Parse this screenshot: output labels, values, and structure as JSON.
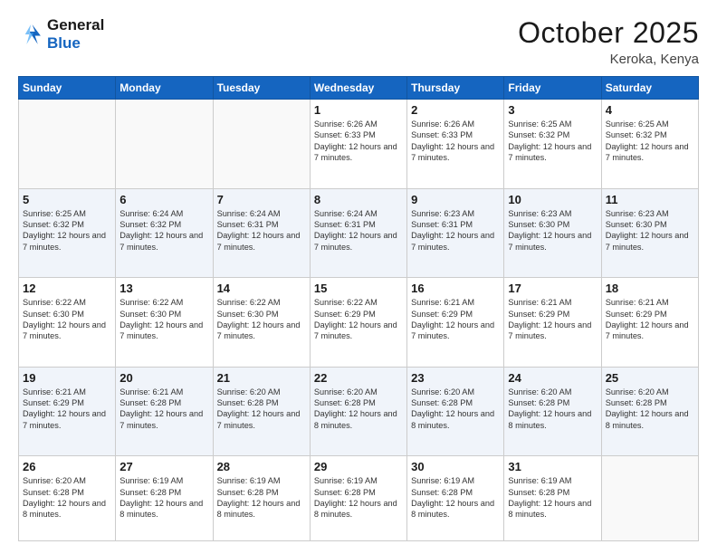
{
  "header": {
    "logo_line1": "General",
    "logo_line2": "Blue",
    "month": "October 2025",
    "location": "Keroka, Kenya"
  },
  "weekdays": [
    "Sunday",
    "Monday",
    "Tuesday",
    "Wednesday",
    "Thursday",
    "Friday",
    "Saturday"
  ],
  "weeks": [
    [
      {
        "day": "",
        "detail": ""
      },
      {
        "day": "",
        "detail": ""
      },
      {
        "day": "",
        "detail": ""
      },
      {
        "day": "1",
        "detail": "Sunrise: 6:26 AM\nSunset: 6:33 PM\nDaylight: 12 hours\nand 7 minutes."
      },
      {
        "day": "2",
        "detail": "Sunrise: 6:26 AM\nSunset: 6:33 PM\nDaylight: 12 hours\nand 7 minutes."
      },
      {
        "day": "3",
        "detail": "Sunrise: 6:25 AM\nSunset: 6:32 PM\nDaylight: 12 hours\nand 7 minutes."
      },
      {
        "day": "4",
        "detail": "Sunrise: 6:25 AM\nSunset: 6:32 PM\nDaylight: 12 hours\nand 7 minutes."
      }
    ],
    [
      {
        "day": "5",
        "detail": "Sunrise: 6:25 AM\nSunset: 6:32 PM\nDaylight: 12 hours\nand 7 minutes."
      },
      {
        "day": "6",
        "detail": "Sunrise: 6:24 AM\nSunset: 6:32 PM\nDaylight: 12 hours\nand 7 minutes."
      },
      {
        "day": "7",
        "detail": "Sunrise: 6:24 AM\nSunset: 6:31 PM\nDaylight: 12 hours\nand 7 minutes."
      },
      {
        "day": "8",
        "detail": "Sunrise: 6:24 AM\nSunset: 6:31 PM\nDaylight: 12 hours\nand 7 minutes."
      },
      {
        "day": "9",
        "detail": "Sunrise: 6:23 AM\nSunset: 6:31 PM\nDaylight: 12 hours\nand 7 minutes."
      },
      {
        "day": "10",
        "detail": "Sunrise: 6:23 AM\nSunset: 6:30 PM\nDaylight: 12 hours\nand 7 minutes."
      },
      {
        "day": "11",
        "detail": "Sunrise: 6:23 AM\nSunset: 6:30 PM\nDaylight: 12 hours\nand 7 minutes."
      }
    ],
    [
      {
        "day": "12",
        "detail": "Sunrise: 6:22 AM\nSunset: 6:30 PM\nDaylight: 12 hours\nand 7 minutes."
      },
      {
        "day": "13",
        "detail": "Sunrise: 6:22 AM\nSunset: 6:30 PM\nDaylight: 12 hours\nand 7 minutes."
      },
      {
        "day": "14",
        "detail": "Sunrise: 6:22 AM\nSunset: 6:30 PM\nDaylight: 12 hours\nand 7 minutes."
      },
      {
        "day": "15",
        "detail": "Sunrise: 6:22 AM\nSunset: 6:29 PM\nDaylight: 12 hours\nand 7 minutes."
      },
      {
        "day": "16",
        "detail": "Sunrise: 6:21 AM\nSunset: 6:29 PM\nDaylight: 12 hours\nand 7 minutes."
      },
      {
        "day": "17",
        "detail": "Sunrise: 6:21 AM\nSunset: 6:29 PM\nDaylight: 12 hours\nand 7 minutes."
      },
      {
        "day": "18",
        "detail": "Sunrise: 6:21 AM\nSunset: 6:29 PM\nDaylight: 12 hours\nand 7 minutes."
      }
    ],
    [
      {
        "day": "19",
        "detail": "Sunrise: 6:21 AM\nSunset: 6:29 PM\nDaylight: 12 hours\nand 7 minutes."
      },
      {
        "day": "20",
        "detail": "Sunrise: 6:21 AM\nSunset: 6:28 PM\nDaylight: 12 hours\nand 7 minutes."
      },
      {
        "day": "21",
        "detail": "Sunrise: 6:20 AM\nSunset: 6:28 PM\nDaylight: 12 hours\nand 7 minutes."
      },
      {
        "day": "22",
        "detail": "Sunrise: 6:20 AM\nSunset: 6:28 PM\nDaylight: 12 hours\nand 8 minutes."
      },
      {
        "day": "23",
        "detail": "Sunrise: 6:20 AM\nSunset: 6:28 PM\nDaylight: 12 hours\nand 8 minutes."
      },
      {
        "day": "24",
        "detail": "Sunrise: 6:20 AM\nSunset: 6:28 PM\nDaylight: 12 hours\nand 8 minutes."
      },
      {
        "day": "25",
        "detail": "Sunrise: 6:20 AM\nSunset: 6:28 PM\nDaylight: 12 hours\nand 8 minutes."
      }
    ],
    [
      {
        "day": "26",
        "detail": "Sunrise: 6:20 AM\nSunset: 6:28 PM\nDaylight: 12 hours\nand 8 minutes."
      },
      {
        "day": "27",
        "detail": "Sunrise: 6:19 AM\nSunset: 6:28 PM\nDaylight: 12 hours\nand 8 minutes."
      },
      {
        "day": "28",
        "detail": "Sunrise: 6:19 AM\nSunset: 6:28 PM\nDaylight: 12 hours\nand 8 minutes."
      },
      {
        "day": "29",
        "detail": "Sunrise: 6:19 AM\nSunset: 6:28 PM\nDaylight: 12 hours\nand 8 minutes."
      },
      {
        "day": "30",
        "detail": "Sunrise: 6:19 AM\nSunset: 6:28 PM\nDaylight: 12 hours\nand 8 minutes."
      },
      {
        "day": "31",
        "detail": "Sunrise: 6:19 AM\nSunset: 6:28 PM\nDaylight: 12 hours\nand 8 minutes."
      },
      {
        "day": "",
        "detail": ""
      }
    ]
  ]
}
